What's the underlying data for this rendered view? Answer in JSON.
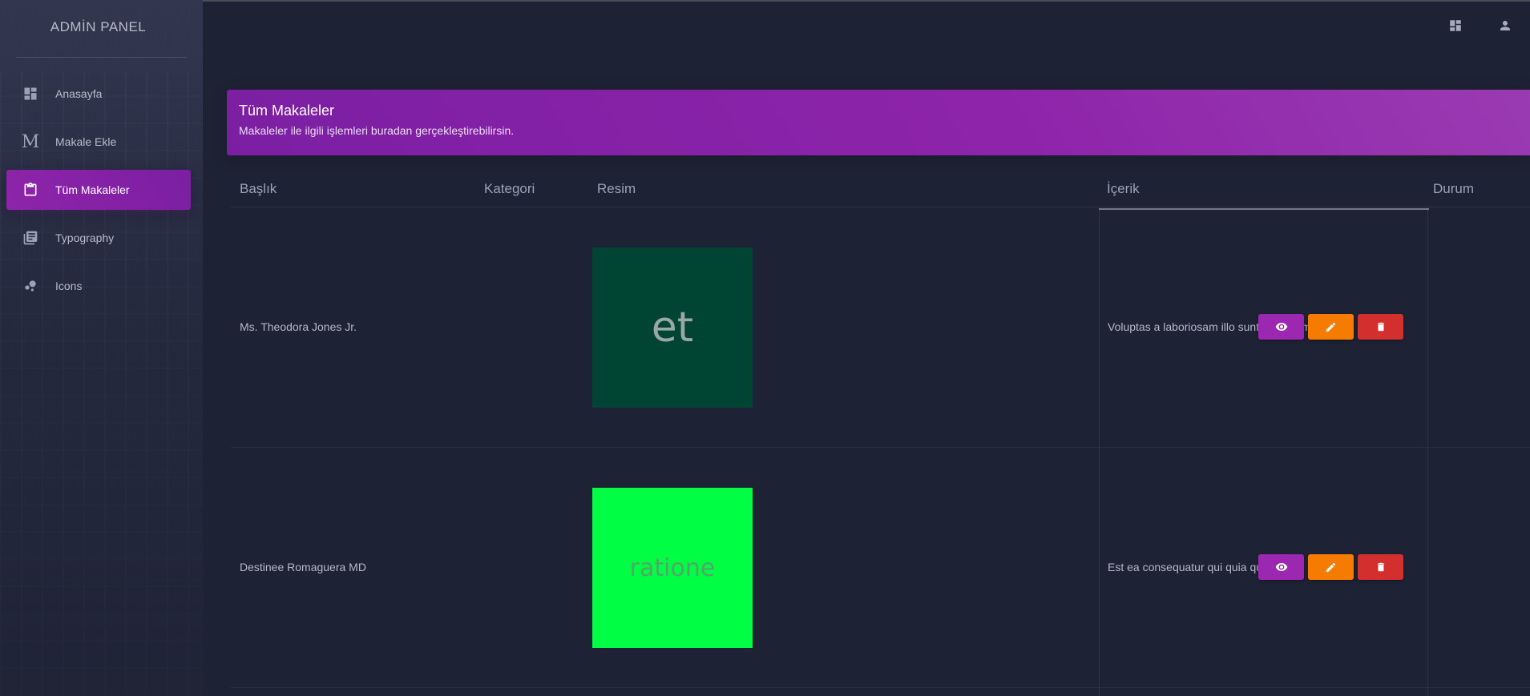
{
  "sidebar": {
    "logo": "ADMİN PANEL",
    "items": [
      {
        "label": "Anasayfa",
        "icon": "dashboard-icon",
        "active": false
      },
      {
        "label": "Makale Ekle",
        "icon": "m-letter-icon",
        "active": false
      },
      {
        "label": "Tüm Makaleler",
        "icon": "clipboard-icon",
        "active": true
      },
      {
        "label": "Typography",
        "icon": "library-books-icon",
        "active": false
      },
      {
        "label": "Icons",
        "icon": "bubble-chart-icon",
        "active": false
      }
    ]
  },
  "topbar": {
    "icons": [
      "dashboard-icon",
      "person-icon"
    ]
  },
  "card": {
    "title": "Tüm Makaleler",
    "subtitle": "Makaleler ile ilgili işlemleri buradan gerçekleştirebilirsin."
  },
  "table": {
    "headers": [
      "Başlık",
      "Kategori",
      "Resim",
      "İçerik",
      "Durum"
    ],
    "rows": [
      {
        "title": "Ms. Theodora Jones Jr.",
        "category": "",
        "image_text": "et",
        "image_bg": "#004433",
        "image_fg": "#9aa8a4",
        "content": "Voluptas a laboriosam illo sunt modi cumque."
      },
      {
        "title": "Destinee Romaguera MD",
        "category": "",
        "image_text": "ratione",
        "image_bg": "#00ff44",
        "image_fg": "#4fa86a",
        "content": "Est ea consequatur qui quia quia."
      }
    ]
  },
  "colors": {
    "accent": "#8e24aa",
    "view_button": "#9c27b0",
    "edit_button": "#f57c00",
    "delete_button": "#d32f2f",
    "background": "#1e2235"
  }
}
